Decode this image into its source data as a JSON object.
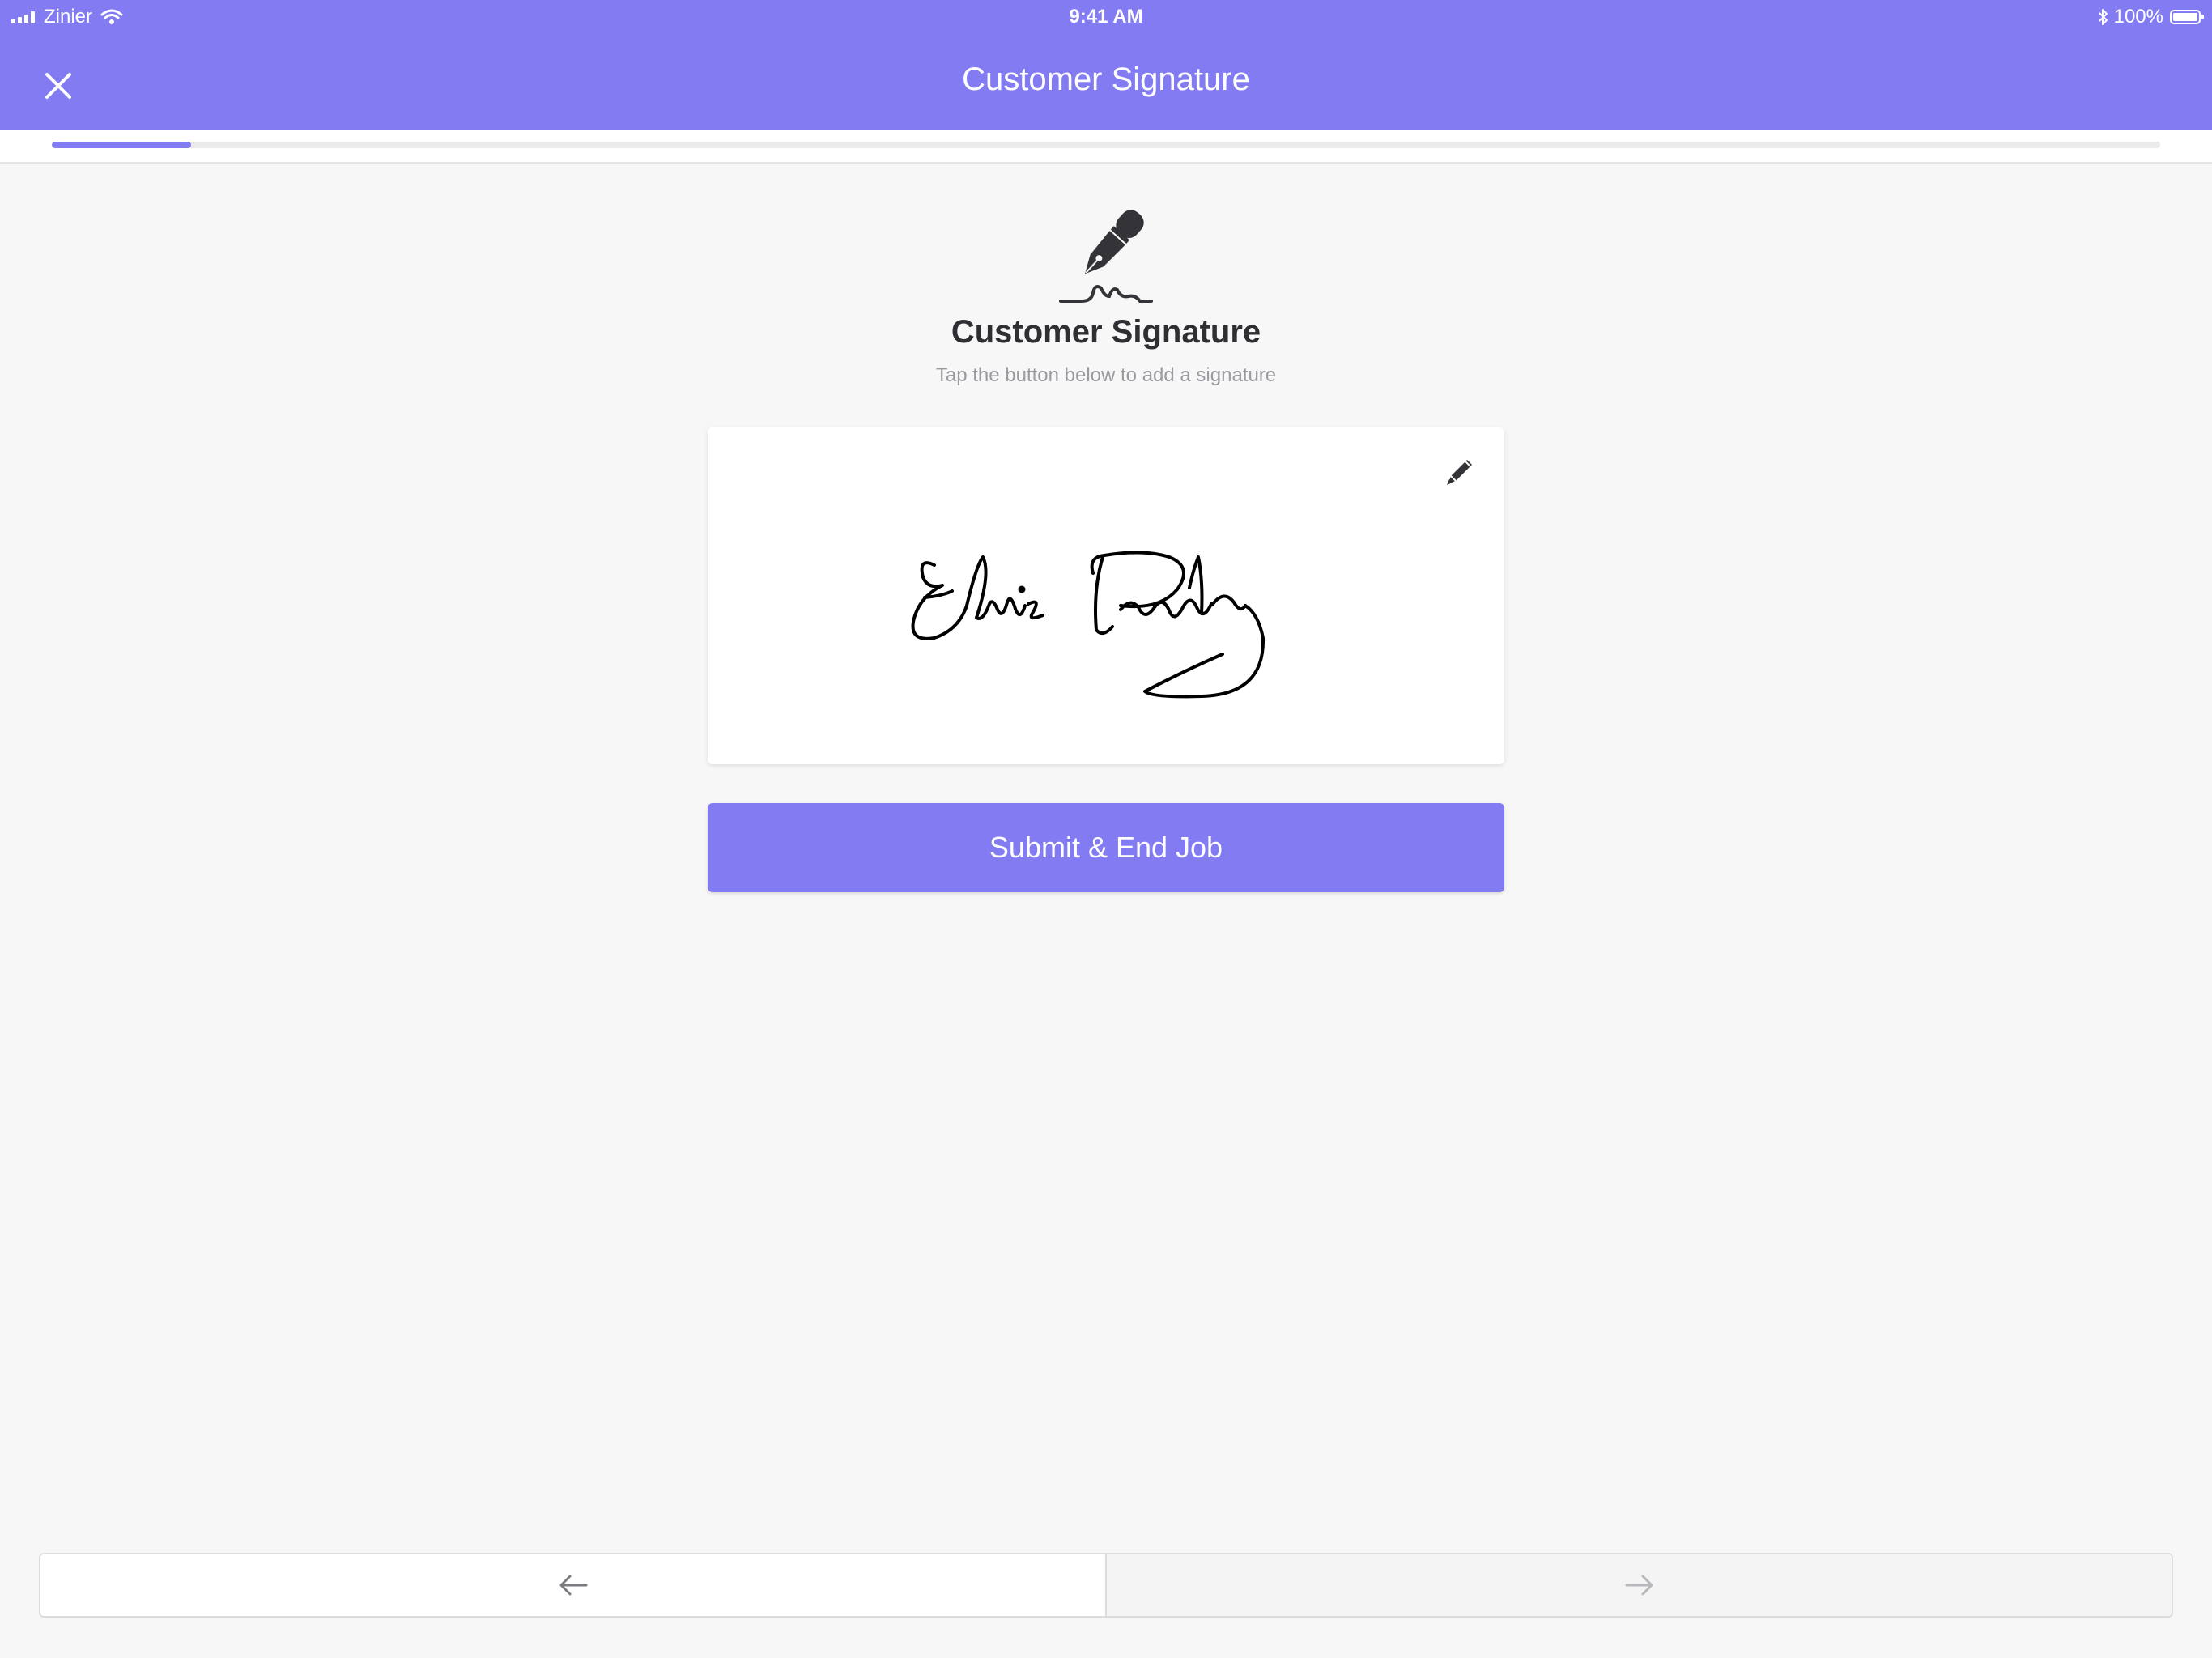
{
  "status_bar": {
    "carrier": "Zinier",
    "time": "9:41 AM",
    "battery": "100%"
  },
  "header": {
    "title": "Customer Signature",
    "close_icon": "close-icon"
  },
  "progress": {
    "fraction": 0.066
  },
  "content": {
    "icon": "fountain-pen-signature-icon",
    "title": "Customer Signature",
    "subtitle": "Tap the button below to add a signature",
    "edit_icon": "pencil-icon"
  },
  "submit": {
    "label": "Submit & End Job"
  },
  "bottom_nav": {
    "back_icon": "arrow-left-icon",
    "next_icon": "arrow-right-icon"
  },
  "colors": {
    "accent": "#837bf2",
    "background": "#f7f7f7"
  }
}
